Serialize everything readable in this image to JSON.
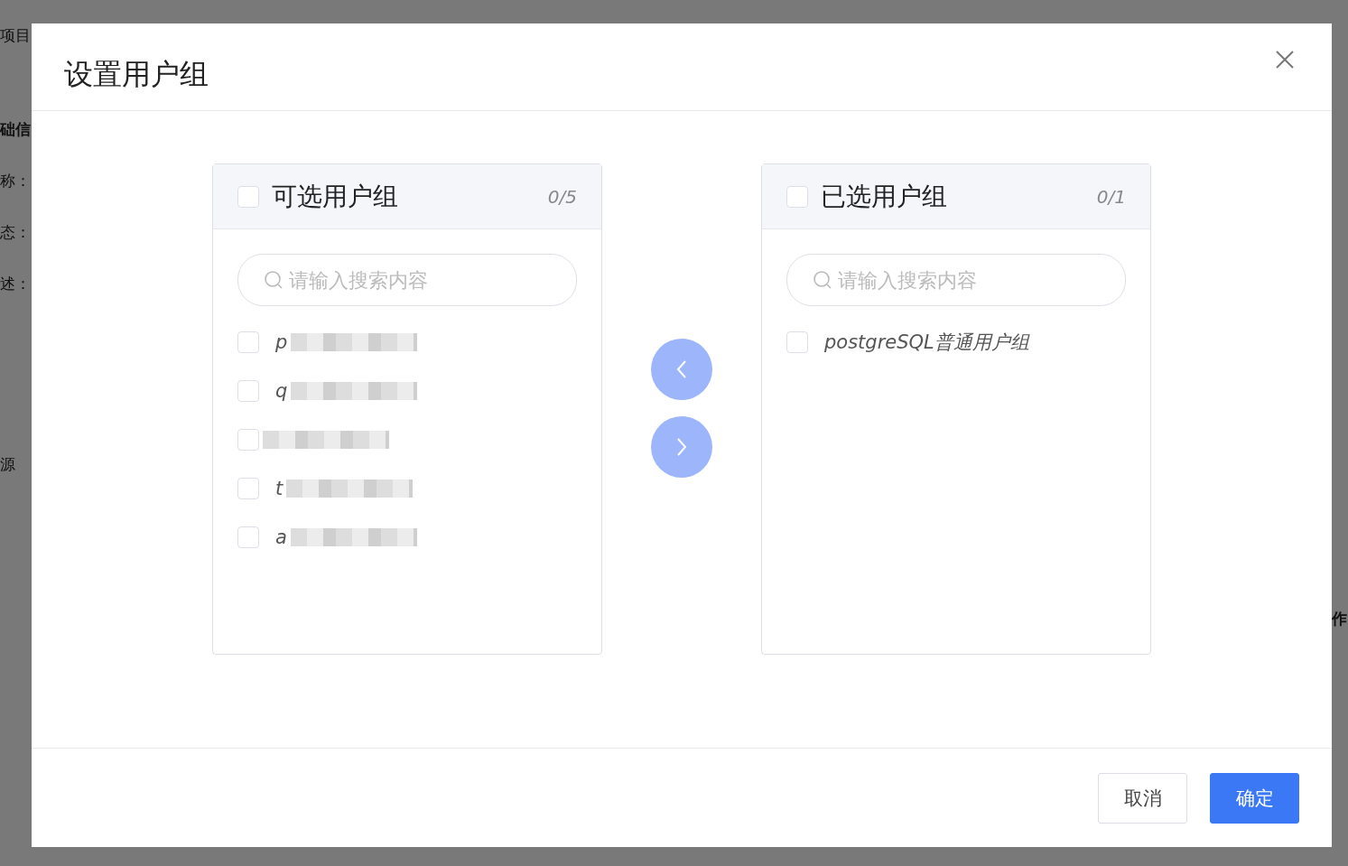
{
  "background": {
    "left_fragments": [
      {
        "text": "项目",
        "kind": "plain"
      },
      {
        "text": "础信",
        "kind": "heading"
      },
      {
        "text": "称：",
        "kind": "plain"
      },
      {
        "text": "态：",
        "kind": "plain"
      },
      {
        "text": "述：",
        "kind": "plain"
      },
      {
        "text": "源",
        "kind": "section"
      }
    ],
    "right_fragment": "作"
  },
  "dialog": {
    "title": "设置用户组",
    "panels": [
      {
        "title": "可选用户组",
        "count": "0/5",
        "checked": false,
        "search": {
          "placeholder": "请输入搜索内容"
        },
        "items": [
          {
            "label": "p",
            "checked": false,
            "redacted": true
          },
          {
            "label": "q",
            "checked": false,
            "redacted": true
          },
          {
            "checked": false,
            "redacted": true
          },
          {
            "label": "t",
            "checked": false,
            "redacted": true
          },
          {
            "label": "a",
            "checked": false,
            "redacted": true
          }
        ]
      },
      {
        "title": "已选用户组",
        "count": "0/1",
        "checked": false,
        "search": {
          "placeholder": "请输入搜索内容"
        },
        "items": [
          {
            "label": "postgreSQL普通用户组",
            "checked": false,
            "redacted": false
          }
        ]
      }
    ],
    "transfer_buttons": [
      {
        "kind": "left",
        "disabled": true
      },
      {
        "kind": "right",
        "disabled": true
      }
    ],
    "buttons": [
      {
        "label": "取消",
        "kind": "default"
      },
      {
        "label": "确定",
        "kind": "primary"
      }
    ]
  }
}
